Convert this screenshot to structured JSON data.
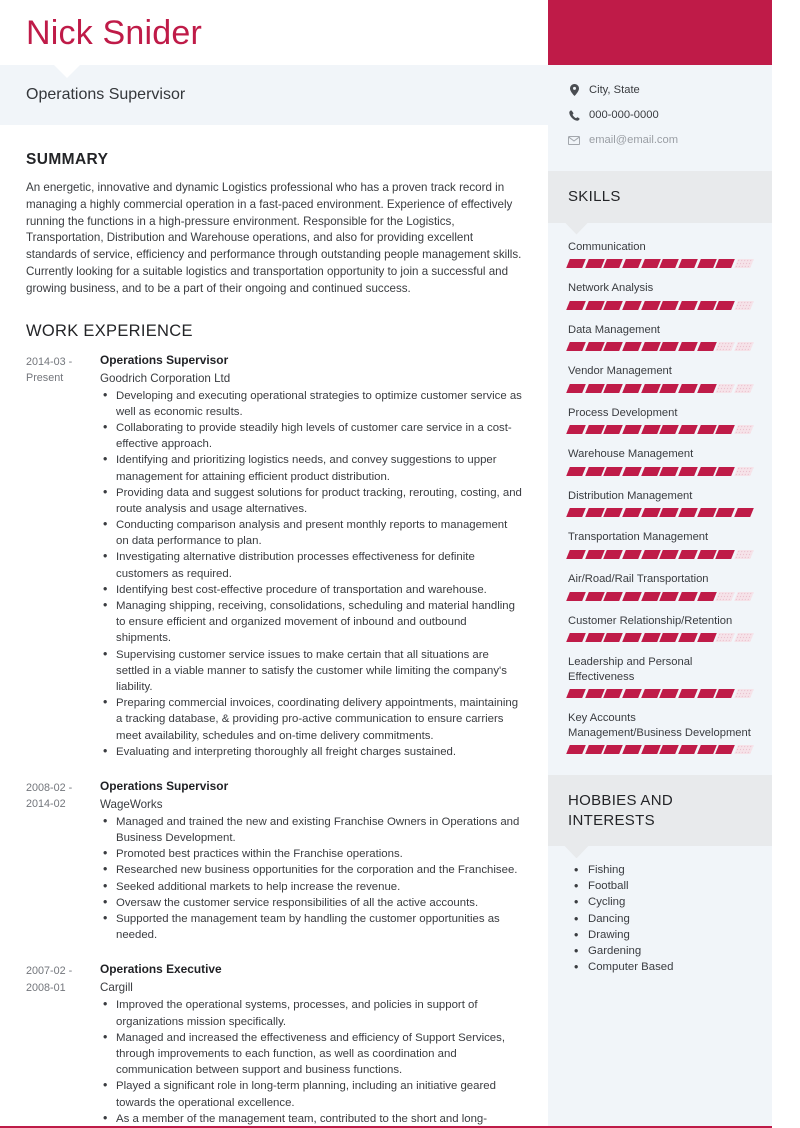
{
  "accent_color": "#bf1b48",
  "sidebar_bg": "#f1f5f9",
  "sidebar_head_bg": "#e8eaec",
  "header": {
    "name": "Nick Snider",
    "job_title": "Operations Supervisor"
  },
  "contact": {
    "location": "City, State",
    "phone": "000-000-0000",
    "email": "email@email.com",
    "icons": [
      "map-pin-icon",
      "phone-icon",
      "envelope-icon"
    ]
  },
  "summary": {
    "heading": "SUMMARY",
    "text": "An energetic, innovative and dynamic Logistics professional who has a proven track record in managing a highly commercial operation in a fast-paced environment. Experience of effectively running the functions in a high-pressure environment. Responsible for the Logistics, Transportation, Distribution and Warehouse operations, and also for providing excellent standards of service, efficiency and performance through outstanding people management skills. Currently looking for a suitable logistics and transportation opportunity to join a successful and growing business, and to be a part of their ongoing and continued success."
  },
  "work_experience": {
    "heading": "WORK EXPERIENCE",
    "jobs": [
      {
        "dates": "2014-03 - Present",
        "role": "Operations Supervisor",
        "company": "Goodrich Corporation Ltd",
        "bullets": [
          "Developing and executing operational strategies to optimize customer service as well as economic results.",
          "Collaborating to provide steadily high levels of customer care service in a cost-effective approach.",
          "Identifying and prioritizing logistics needs, and convey suggestions to upper management for attaining efficient product distribution.",
          "Providing data and suggest solutions for product tracking, rerouting, costing, and route analysis and usage alternatives.",
          "Conducting comparison analysis and present monthly reports to management on data performance to plan.",
          "Investigating alternative distribution processes effectiveness for definite customers as required.",
          "Identifying best cost-effective procedure of transportation and warehouse.",
          "Managing shipping, receiving, consolidations, scheduling and material handling to ensure efficient and organized movement of inbound and outbound shipments.",
          "Supervising customer service issues to make certain that all situations are settled in a viable manner to satisfy the customer while limiting the company's liability.",
          "Preparing commercial invoices, coordinating delivery appointments, maintaining a tracking database, & providing pro-active communication to ensure carriers meet availability, schedules and on-time delivery commitments.",
          "Evaluating and interpreting thoroughly all freight charges sustained."
        ]
      },
      {
        "dates": "2008-02 - 2014-02",
        "role": "Operations Supervisor",
        "company": "WageWorks",
        "bullets": [
          "Managed and trained the new and existing Franchise Owners in Operations and Business Development.",
          "Promoted best practices within the Franchise operations.",
          "Researched new business opportunities for the corporation and the Franchisee.",
          "Seeked additional markets to help increase the revenue.",
          "Oversaw the customer service responsibilities of all the active accounts.",
          "Supported the management team by handling the customer opportunities as needed."
        ]
      },
      {
        "dates": "2007-02 - 2008-01",
        "role": "Operations Executive",
        "company": "Cargill",
        "bullets": [
          "Improved the operational systems, processes, and policies in support of organizations mission specifically.",
          "Managed and increased the effectiveness and efficiency of Support Services, through improvements to each function, as well as coordination and communication between support and business functions.",
          "Played a significant role in long-term planning, including an initiative geared towards the operational excellence.",
          "As a member of the management team, contributed to the short and long-"
        ]
      }
    ]
  },
  "skills": {
    "heading": "SKILLS",
    "total_segments": 10,
    "items": [
      {
        "label": "Communication",
        "filled": 9
      },
      {
        "label": "Network Analysis",
        "filled": 9
      },
      {
        "label": "Data Management",
        "filled": 8
      },
      {
        "label": "Vendor Management",
        "filled": 8
      },
      {
        "label": "Process Development",
        "filled": 9
      },
      {
        "label": "Warehouse Management",
        "filled": 9
      },
      {
        "label": "Distribution Management",
        "filled": 10
      },
      {
        "label": "Transportation Management",
        "filled": 9
      },
      {
        "label": "Air/Road/Rail Transportation",
        "filled": 8
      },
      {
        "label": "Customer Relationship/Retention",
        "filled": 8
      },
      {
        "label": "Leadership and Personal Effectiveness",
        "filled": 9
      },
      {
        "label": "Key Accounts Management/Business Development",
        "filled": 9
      }
    ]
  },
  "hobbies": {
    "heading": "HOBBIES AND INTERESTS",
    "items": [
      "Fishing",
      "Football",
      "Cycling",
      "Dancing",
      "Drawing",
      "Gardening",
      "Computer Based"
    ]
  }
}
